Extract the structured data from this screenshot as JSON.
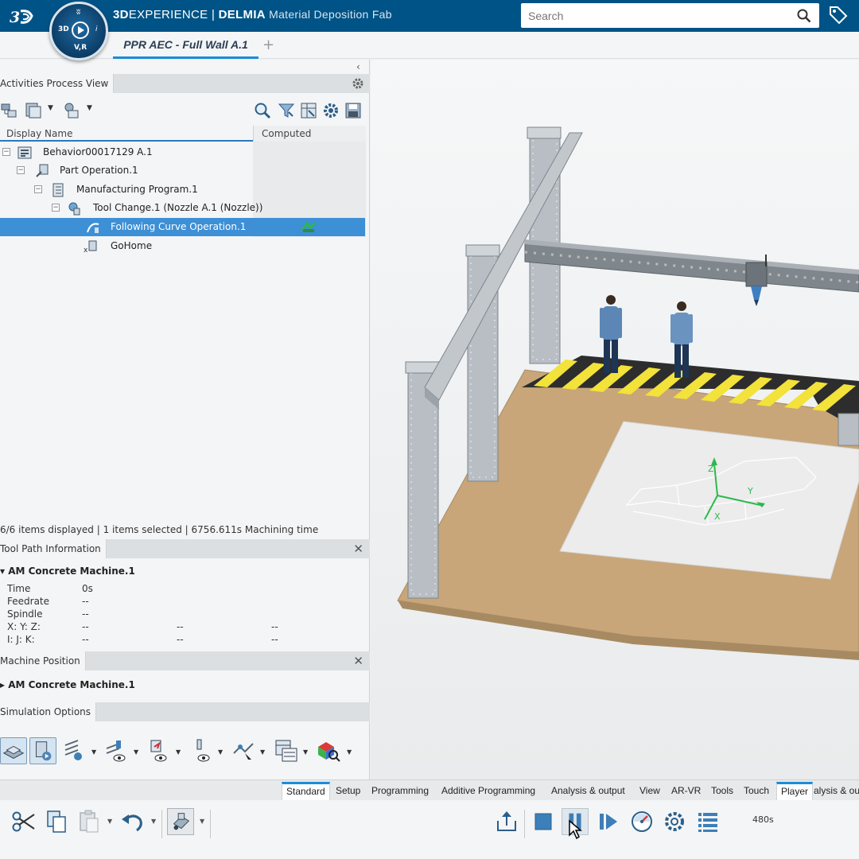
{
  "top": {
    "brand_bold": "3D",
    "brand_thin": "EXPERIENCE",
    "brand_sep": " | ",
    "brand_company": "DELMIA",
    "brand_app": " Material Deposition Fab",
    "compass_3d": "3D",
    "compass_vr": "V,R",
    "search_placeholder": "Search"
  },
  "doc_tab": {
    "label": "PPR AEC - Full Wall A.1",
    "add": "+"
  },
  "activities": {
    "title": "Activities Process View",
    "col_display_name": "Display Name",
    "col_computed": "Computed",
    "tree": [
      {
        "label": "Behavior00017129 A.1",
        "level": 0
      },
      {
        "label": "Part Operation.1",
        "level": 1
      },
      {
        "label": "Manufacturing Program.1",
        "level": 2
      },
      {
        "label": "Tool Change.1 (Nozzle A.1 (Nozzle))",
        "level": 3
      },
      {
        "label": "Following Curve Operation.1",
        "level": 4,
        "selected": true
      },
      {
        "label": "GoHome",
        "level": 4
      }
    ],
    "status": "6/6 items displayed | 1 items selected | 6756.611s Machining time"
  },
  "tool_path": {
    "title": "Tool Path Information",
    "machine": "AM Concrete Machine.1",
    "rows": [
      {
        "label": "Time",
        "v1": "0s"
      },
      {
        "label": "Feedrate",
        "v1": "--"
      },
      {
        "label": "Spindle",
        "v1": "--"
      },
      {
        "label": "X: Y: Z:",
        "v1": "--",
        "v2": "--",
        "v3": "--"
      },
      {
        "label": "I: J: K:",
        "v1": "--",
        "v2": "--",
        "v3": "--"
      }
    ]
  },
  "machine_position": {
    "title": "Machine Position",
    "machine": "AM Concrete Machine.1"
  },
  "simulation_options": {
    "title": "Simulation Options"
  },
  "viewport": {
    "axis_x": "X",
    "axis_y": "Y",
    "axis_z": "Z"
  },
  "bottom_tabs": [
    {
      "label": "Standard",
      "active": true
    },
    {
      "label": "Setup"
    },
    {
      "label": "Programming"
    },
    {
      "label": "Additive Programming"
    },
    {
      "label": "Analysis & output"
    },
    {
      "label": "View"
    },
    {
      "label": "AR-VR"
    },
    {
      "label": "Tools"
    },
    {
      "label": "Touch"
    },
    {
      "label": "Player",
      "active": true
    },
    {
      "label": "alysis & out"
    }
  ],
  "player": {
    "time": "480s"
  }
}
